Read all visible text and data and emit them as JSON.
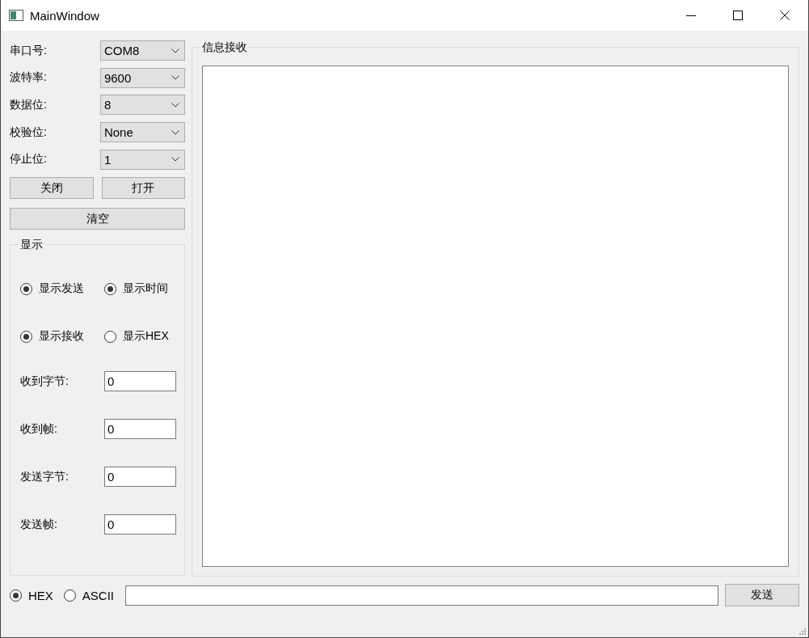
{
  "window": {
    "title": "MainWindow"
  },
  "serial_settings": [
    {
      "label": "串口号:",
      "value": "COM8"
    },
    {
      "label": "波特率:",
      "value": "9600"
    },
    {
      "label": "数据位:",
      "value": "8"
    },
    {
      "label": "校验位:",
      "value": "None"
    },
    {
      "label": "停止位:",
      "value": "1"
    }
  ],
  "port_buttons": [
    "关闭",
    "打开"
  ],
  "clear_button": "清空",
  "display": {
    "title": "显示",
    "options": [
      {
        "label": "显示发送",
        "checked": true
      },
      {
        "label": "显示时间",
        "checked": true
      },
      {
        "label": "显示接收",
        "checked": true
      },
      {
        "label": "显示HEX",
        "checked": false
      }
    ],
    "counters": [
      {
        "label": "收到字节:",
        "value": "0"
      },
      {
        "label": "收到帧:",
        "value": "0"
      },
      {
        "label": "发送字节:",
        "value": "0"
      },
      {
        "label": "发送帧:",
        "value": "0"
      }
    ]
  },
  "receive": {
    "title": "信息接收"
  },
  "send": {
    "modes": [
      {
        "label": "HEX",
        "selected": true
      },
      {
        "label": "ASCII",
        "selected": false
      }
    ],
    "button": "发送"
  }
}
